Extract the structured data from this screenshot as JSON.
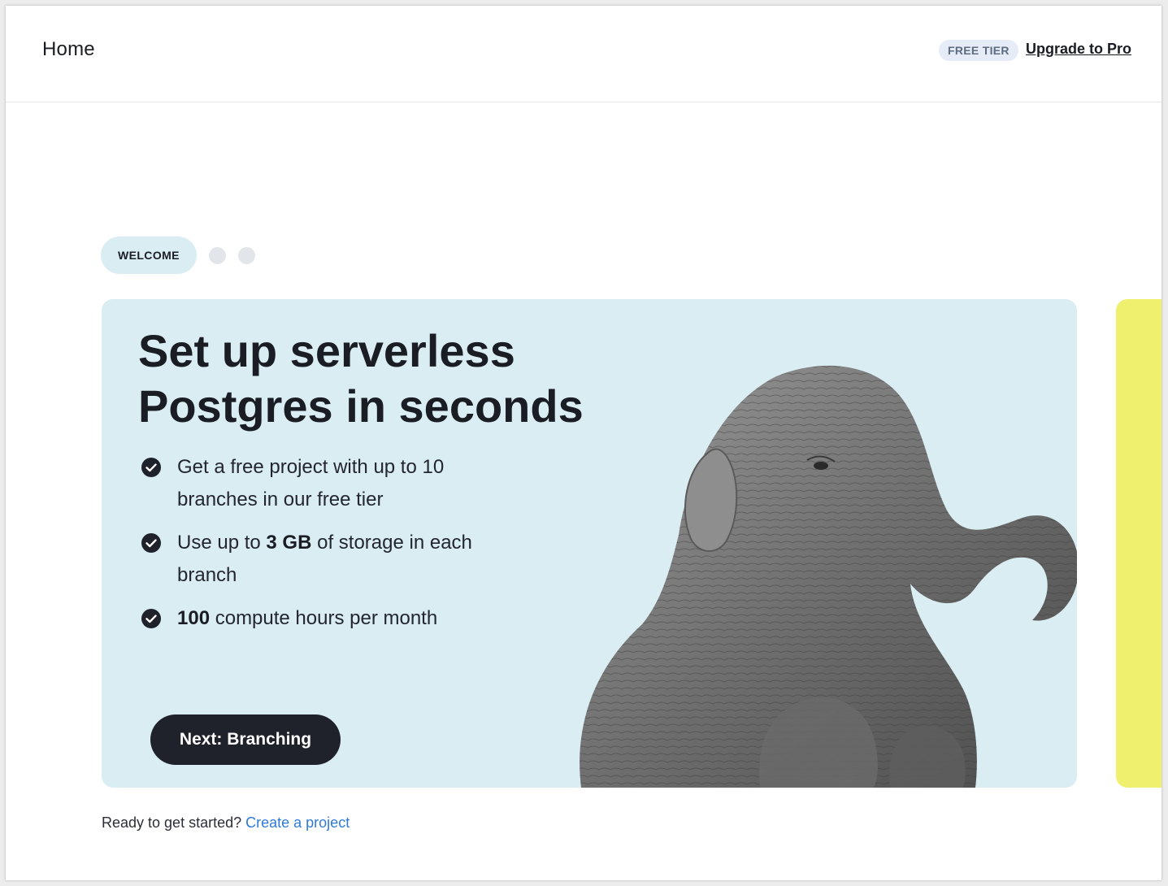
{
  "header": {
    "title": "Home",
    "tier_badge": "FREE TIER",
    "upgrade_link": "Upgrade to Pro"
  },
  "stepper": {
    "active_label": "WELCOME",
    "total_steps": 3,
    "active_index": 0
  },
  "card": {
    "headline_line1": "Set up serverless",
    "headline_line2": "Postgres in seconds",
    "features": [
      {
        "text": "Get a free project with up to 10 branches in our free tier"
      },
      {
        "pre": "Use up to ",
        "bold": "3 GB",
        "post": " of storage in each branch"
      },
      {
        "bold": "100",
        "post": " compute hours per month"
      }
    ],
    "next_button": "Next: Branching",
    "image": "elephant-illustration",
    "background": "#d9edf2"
  },
  "next_card_color": "#eef06e",
  "footer": {
    "prompt": "Ready to get started?",
    "link": "Create a project"
  },
  "colors": {
    "dark": "#1f222b",
    "link": "#2f7bd8"
  }
}
